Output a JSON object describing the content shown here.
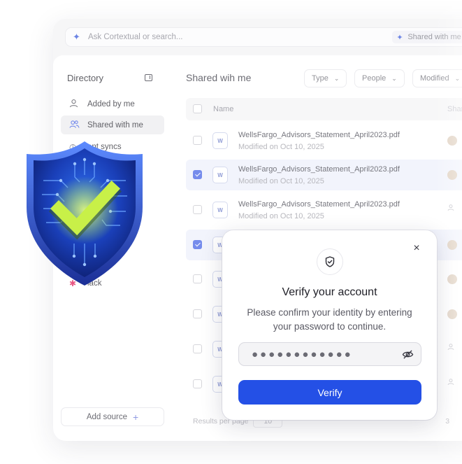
{
  "topbar": {
    "search_placeholder": "Ask Cortextual or search...",
    "chip_label": "Shared with me"
  },
  "sidebar": {
    "title": "Directory",
    "items": [
      {
        "label": "Added by me",
        "icon": "user-icon"
      },
      {
        "label": "Shared with me",
        "icon": "users-icon",
        "active": true
      },
      {
        "label": "Recent syncs",
        "icon": "clock-icon",
        "visible_text": "ent syncs"
      },
      {
        "label": "Slack",
        "icon": "slack-icon",
        "visible_text": "lack"
      }
    ],
    "add_source_label": "Add source"
  },
  "main": {
    "title": "Shared wih me",
    "filters": [
      "Type",
      "People",
      "Modified"
    ],
    "columns": {
      "name": "Name",
      "shared": "Shar"
    },
    "rows": [
      {
        "name": "WellsFargo_Advisors_Statement_April2023.pdf",
        "modified": "Modified on Oct 10, 2025",
        "checked": false
      },
      {
        "name": "WellsFargo_Advisors_Statement_April2023.pdf",
        "modified": "Modified on Oct 10, 2025",
        "checked": true
      },
      {
        "name": "WellsFargo_Advisors_Statement_April2023.pdf",
        "modified": "Modified on Oct 10, 2025",
        "checked": false
      },
      {
        "name": "",
        "modified": "",
        "checked": true
      },
      {
        "name": "",
        "modified": "",
        "checked": false
      },
      {
        "name": "",
        "modified": "",
        "checked": false
      },
      {
        "name": "",
        "modified": "",
        "checked": false
      },
      {
        "name": "",
        "modified": "",
        "checked": false
      }
    ],
    "footer": {
      "results_label": "Results per page",
      "per_page": "10",
      "page_count": "3"
    }
  },
  "modal": {
    "title": "Verify your account",
    "description": "Please confirm your identity by entering your password to continue.",
    "password_mask": "●●●●●●●●●●●●",
    "button_label": "Verify",
    "close_label": "×"
  },
  "colors": {
    "accent": "#2450e6",
    "checkbox": "#4866e6",
    "shield_blue": "#1a3fb8",
    "check_green": "#c8f048"
  }
}
